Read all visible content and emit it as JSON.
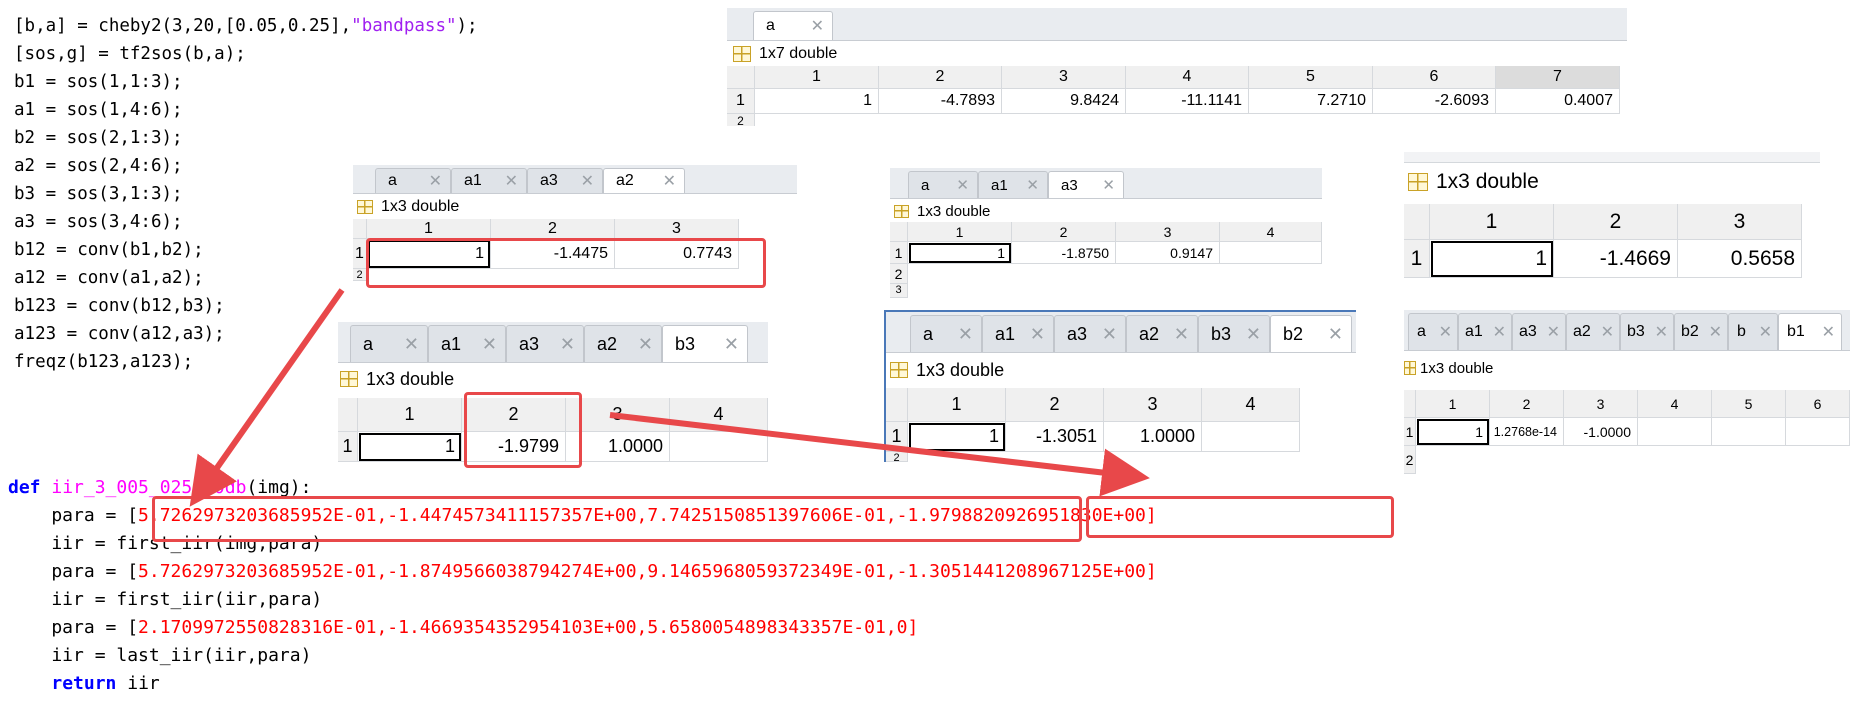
{
  "matlab": {
    "line1_pre": "[b,a] = cheby2(3,20,[0.05,0.25],",
    "line1_str": "\"bandpass\"",
    "line1_post": ");",
    "lines": [
      "[sos,g] = tf2sos(b,a);",
      "b1 = sos(1,1:3);",
      "a1 = sos(1,4:6);",
      "b2 = sos(2,1:3);",
      "a2 = sos(2,4:6);",
      "b3 = sos(3,1:3);",
      "a3 = sos(3,4:6);",
      "b12 = conv(b1,b2);",
      "a12 = conv(a1,a2);",
      "b123 = conv(b12,b3);",
      "a123 = conv(a12,a3);",
      "freqz(b123,a123);"
    ]
  },
  "python": {
    "def_kw": "def",
    "func_name": "iir_3_005_025_20db",
    "def_args": "(img):",
    "line1_pre": "    para = [",
    "p1_vals": "5.7262973203685952E-01,-1.4474573411157357E+00,7.7425150851397606E-01,",
    "p1_last": "-1.9798820926951830E+00]",
    "line2": "    iir = first_iir(img,para)",
    "line3_pre": "    para = [",
    "p2_vals": "5.7262973203685952E-01,-1.8749566038794274E+00,9.1465968059372349E-01,-1.3051441208967125E+00]",
    "line4": "    iir = first_iir(iir,para)",
    "line5_pre": "    para = [",
    "p3_vals": "2.1709972550828316E-01,-1.4669354352954103E+00,5.6580054898343357E-01,0]",
    "line6": "    iir = last_iir(iir,para)",
    "ret_kw": "return",
    "ret_val": " iir"
  },
  "panel_a": {
    "tabs": [
      "a"
    ],
    "active_tab": "a",
    "dims": "1x7 double",
    "cols": [
      "1",
      "2",
      "3",
      "4",
      "5",
      "6",
      "7"
    ],
    "rows": [
      {
        "label": "1",
        "cells": [
          "1",
          "-4.7893",
          "9.8424",
          "-11.1141",
          "7.2710",
          "-2.6093",
          "0.4007"
        ]
      }
    ],
    "extra_row": "2"
  },
  "panel_a2": {
    "tabs": [
      "a",
      "a1",
      "a3",
      "a2"
    ],
    "active_tab": "a2",
    "dims": "1x3 double",
    "cols": [
      "1",
      "2",
      "3"
    ],
    "rows": [
      {
        "label": "1",
        "cells": [
          "1",
          "-1.4475",
          "0.7743"
        ]
      }
    ],
    "extra_row": "2"
  },
  "panel_a3": {
    "tabs": [
      "a",
      "a1",
      "a3"
    ],
    "active_tab": "a3",
    "dims": "1x3 double",
    "cols": [
      "1",
      "2",
      "3",
      "4"
    ],
    "rows": [
      {
        "label": "1",
        "cells": [
          "1",
          "-1.8750",
          "0.9147",
          ""
        ]
      }
    ],
    "extra_rows": [
      "2",
      "3"
    ]
  },
  "panel_a1": {
    "dims": "1x3 double",
    "cols": [
      "1",
      "2",
      "3"
    ],
    "rows": [
      {
        "label": "1",
        "cells": [
          "1",
          "-1.4669",
          "0.5658"
        ]
      }
    ]
  },
  "panel_b3": {
    "tabs": [
      "a",
      "a1",
      "a3",
      "a2",
      "b3"
    ],
    "active_tab": "b3",
    "dims": "1x3 double",
    "cols": [
      "1",
      "2",
      "3",
      "4"
    ],
    "rows": [
      {
        "label": "1",
        "cells": [
          "1",
          "-1.9799",
          "1.0000",
          ""
        ]
      }
    ]
  },
  "panel_b2": {
    "tabs": [
      "a",
      "a1",
      "a3",
      "a2",
      "b3",
      "b2"
    ],
    "active_tab": "b2",
    "dims": "1x3 double",
    "cols": [
      "1",
      "2",
      "3",
      "4"
    ],
    "rows": [
      {
        "label": "1",
        "cells": [
          "1",
          "-1.3051",
          "1.0000",
          ""
        ]
      }
    ],
    "extra_row": "2"
  },
  "panel_b1": {
    "tabs": [
      "a",
      "a1",
      "a3",
      "a2",
      "b3",
      "b2",
      "b",
      "b1"
    ],
    "active_tab": "b1",
    "dims": "1x3 double",
    "cols": [
      "1",
      "2",
      "3",
      "4",
      "5",
      "6"
    ],
    "rows": [
      {
        "label": "1",
        "cells": [
          "1",
          "1.2768e-14",
          "-1.0000",
          "",
          "",
          ""
        ]
      }
    ],
    "extra_row": "2"
  },
  "colors": {
    "annotation_red": "#e8484a",
    "code_red": "#ff0000",
    "keyword_blue": "#0000ff",
    "func_magenta": "#ff00ff",
    "string_purple": "#a020f0"
  },
  "icons": {
    "close": "close-icon",
    "grid": "grid-icon"
  }
}
